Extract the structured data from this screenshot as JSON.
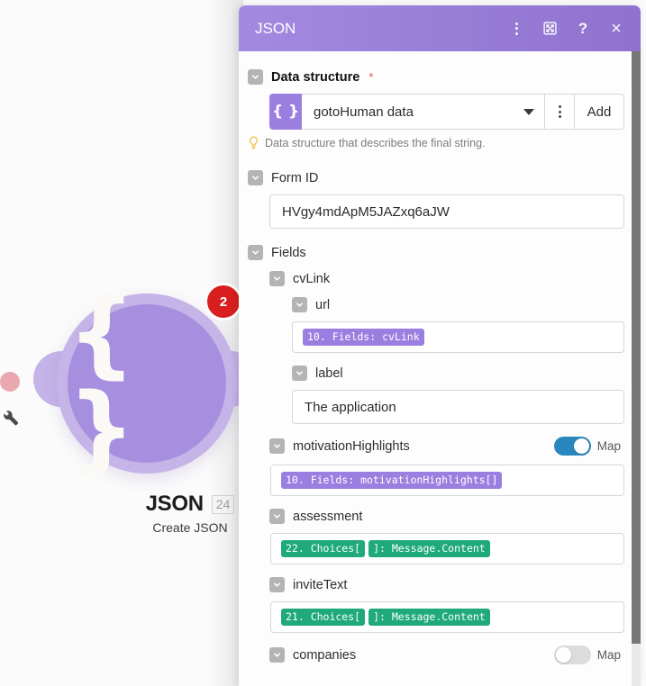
{
  "canvas": {
    "node": {
      "glyph": "{ }",
      "badge_count": "2",
      "title": "JSON",
      "sequence": "24",
      "subtitle": "Create JSON"
    }
  },
  "panel": {
    "title": "JSON",
    "header_icons": [
      {
        "name": "more-options-icon",
        "glyph": "⋮"
      },
      {
        "name": "expand-icon",
        "glyph": "⤢"
      },
      {
        "name": "help-icon",
        "glyph": "?"
      },
      {
        "name": "close-icon",
        "glyph": "×"
      }
    ],
    "data_structure": {
      "label": "Data structure",
      "required_mark": "*",
      "icon_glyph": "{ }",
      "selected": "gotoHuman data",
      "add_label": "Add",
      "hint": "Data structure that describes the final string."
    },
    "form_id": {
      "label": "Form ID",
      "value": "HVgy4mdApM5JAZxq6aJW"
    },
    "fields": {
      "label": "Fields",
      "items": [
        {
          "label": "cvLink",
          "level": 2,
          "type": "group",
          "children": [
            {
              "label": "url",
              "level": 3,
              "type": "chips",
              "chips": [
                {
                  "text": "10. Fields: cvLink",
                  "color": "purple"
                }
              ]
            },
            {
              "label": "label",
              "level": 3,
              "type": "text",
              "value": "The application"
            }
          ]
        },
        {
          "label": "motivationHighlights",
          "level": 2,
          "type": "chips",
          "map_toggle": {
            "label": "Map",
            "state": "on"
          },
          "chips": [
            {
              "text": "10. Fields: motivationHighlights[]",
              "color": "purple"
            }
          ]
        },
        {
          "label": "assessment",
          "level": 2,
          "type": "chips",
          "chips": [
            {
              "text": "22. Choices[",
              "color": "green"
            },
            {
              "text": "]: Message.Content",
              "color": "green"
            }
          ]
        },
        {
          "label": "inviteText",
          "level": 2,
          "type": "chips",
          "chips": [
            {
              "text": "21. Choices[",
              "color": "green"
            },
            {
              "text": "]: Message.Content",
              "color": "green"
            }
          ]
        },
        {
          "label": "companies",
          "level": 2,
          "type": "group",
          "map_toggle": {
            "label": "Map",
            "state": "off"
          }
        }
      ]
    }
  },
  "colors": {
    "accent_purple": "#9b7fe0",
    "header_gradient_from": "#a38ae0",
    "header_gradient_to": "#8f72cf",
    "badge_red": "#d81e1e",
    "toggle_on_blue": "#2a87bd",
    "chip_green": "#1fa97c",
    "node_halo": "#c5b4e8",
    "node_fill": "#a78fe0"
  }
}
